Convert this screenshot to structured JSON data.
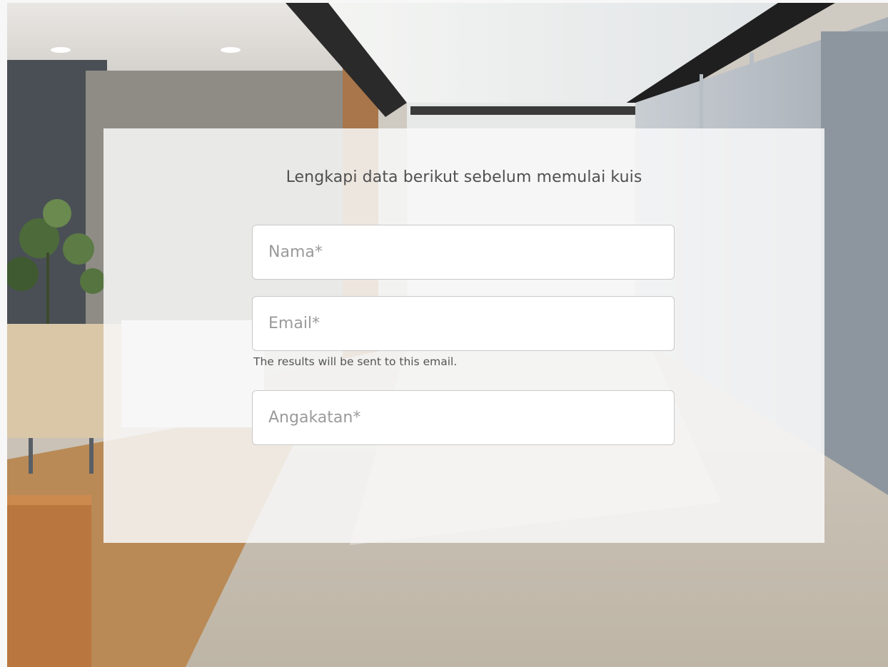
{
  "form": {
    "title": "Lengkapi data berikut sebelum memulai kuis",
    "name_placeholder": "Nama*",
    "email_placeholder": "Email*",
    "email_hint": "The results will be sent to this email.",
    "angkatan_placeholder": "Angakatan*"
  },
  "colors": {
    "page_background": "#f7f7f7",
    "card_background": "#f8f8f8",
    "title_text": "#505050",
    "placeholder_text": "#9a9a9a",
    "field_border": "#c9c9c9"
  }
}
